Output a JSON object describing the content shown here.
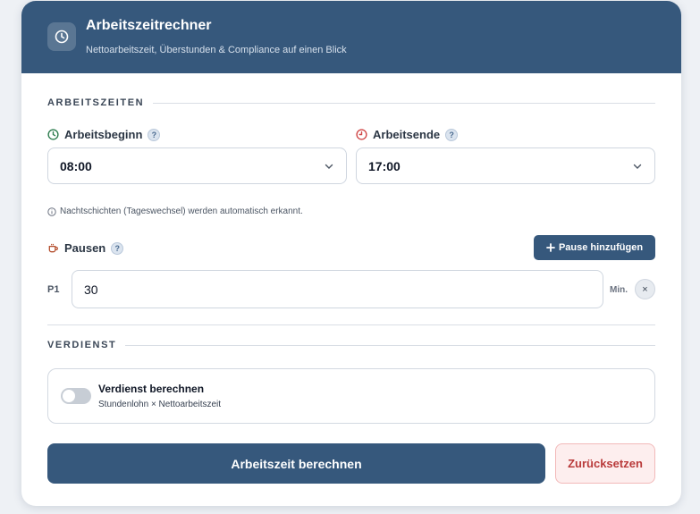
{
  "header": {
    "title": "Arbeitszeitrechner",
    "subtitle": "Nettoarbeitszeit, Überstunden & Compliance auf einen Blick",
    "icon": "clock-icon"
  },
  "sections": {
    "work_times": "ARBEITSZEITEN",
    "earnings": "VERDIENST"
  },
  "start": {
    "label": "Arbeitsbeginn",
    "value": "08:00",
    "icon": "clock-start-icon",
    "color": "#2e7d4f"
  },
  "end": {
    "label": "Arbeitsende",
    "value": "17:00",
    "icon": "clock-end-icon",
    "color": "#d04848"
  },
  "help_glyph": "?",
  "night_hint": "Nachtschichten (Tageswechsel) werden automatisch erkannt.",
  "pauses": {
    "label": "Pausen",
    "add_label": "Pause hinzufügen",
    "items": [
      {
        "id": "P1",
        "value": "30",
        "unit": "Min.",
        "remove": "×"
      }
    ]
  },
  "earnings_toggle": {
    "title": "Verdienst berechnen",
    "subtitle": "Stundenlohn × Nettoarbeitszeit",
    "enabled": false
  },
  "actions": {
    "calculate": "Arbeitszeit berechnen",
    "reset": "Zurücksetzen"
  },
  "colors": {
    "brand": "#36587c",
    "danger": "#b93a3a"
  }
}
